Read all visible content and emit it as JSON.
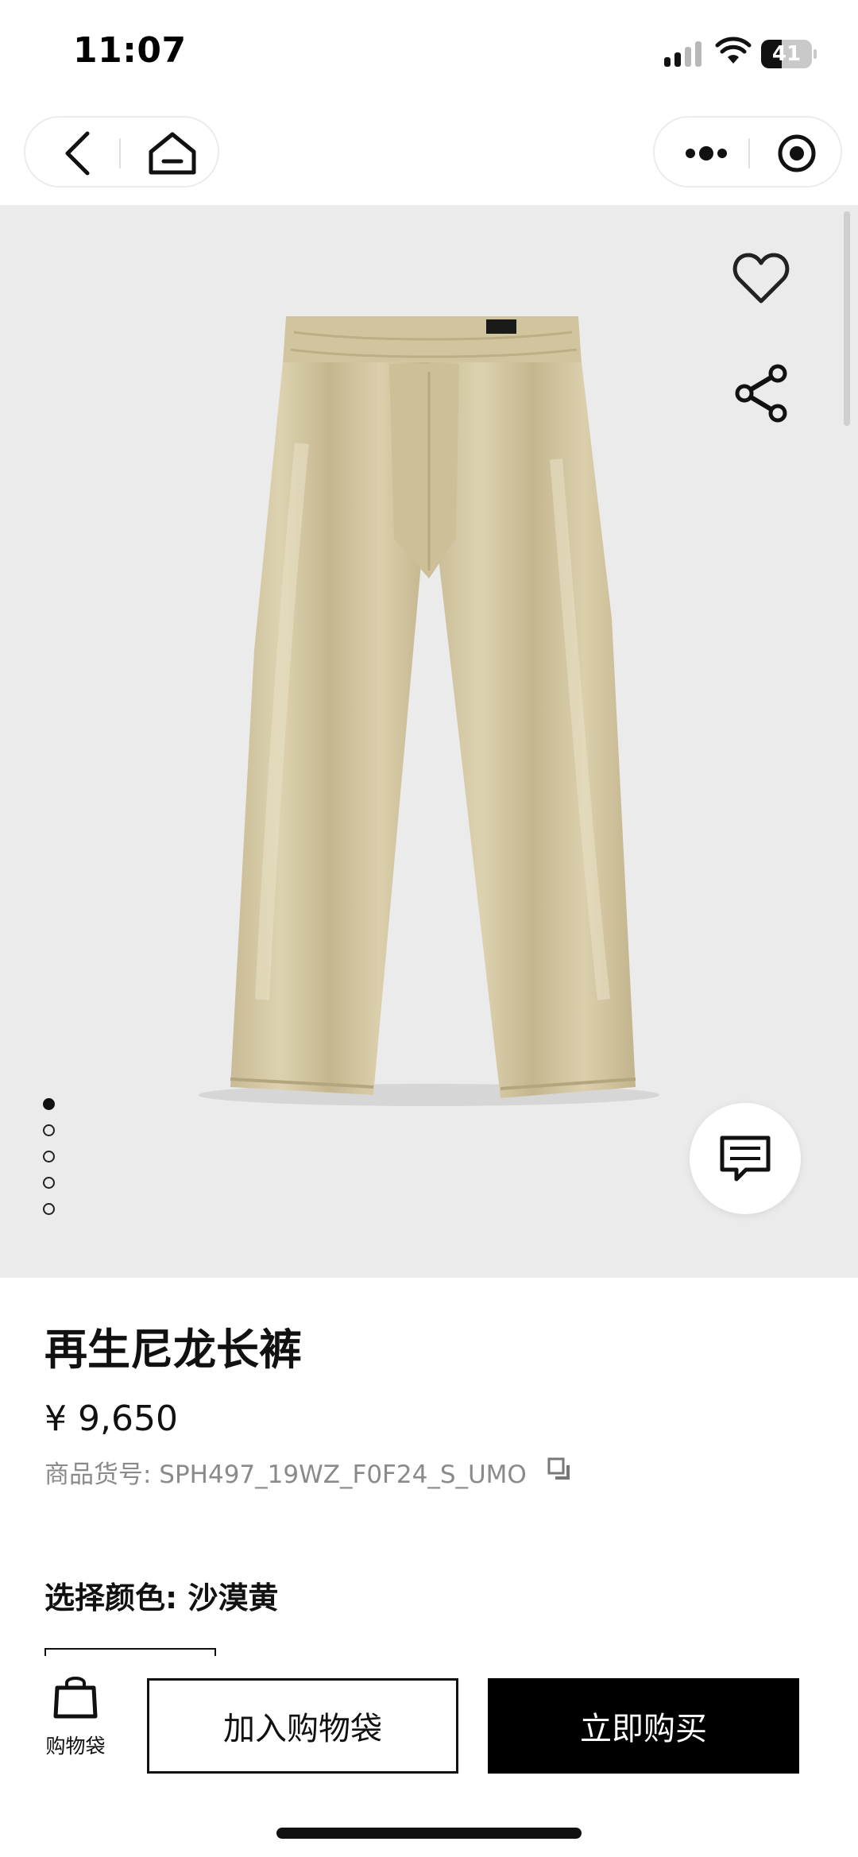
{
  "status_bar": {
    "time": "11:07",
    "battery_level": "41"
  },
  "product": {
    "title": "再生尼龙长裤",
    "price": "¥ 9,650",
    "sku": "商品货号: SPH497_19WZ_F0F24_S_UMO",
    "color_label": "选择颜色: 沙漠黄",
    "image_count": 5,
    "active_image": 1
  },
  "bottom_bar": {
    "bag_label": "购物袋",
    "add_to_bag": "加入购物袋",
    "buy_now": "立即购买"
  },
  "icons": [
    "back-icon",
    "home-icon",
    "more-icon",
    "target-icon",
    "heart-icon",
    "share-icon",
    "chat-icon",
    "copy-icon",
    "bag-icon"
  ]
}
